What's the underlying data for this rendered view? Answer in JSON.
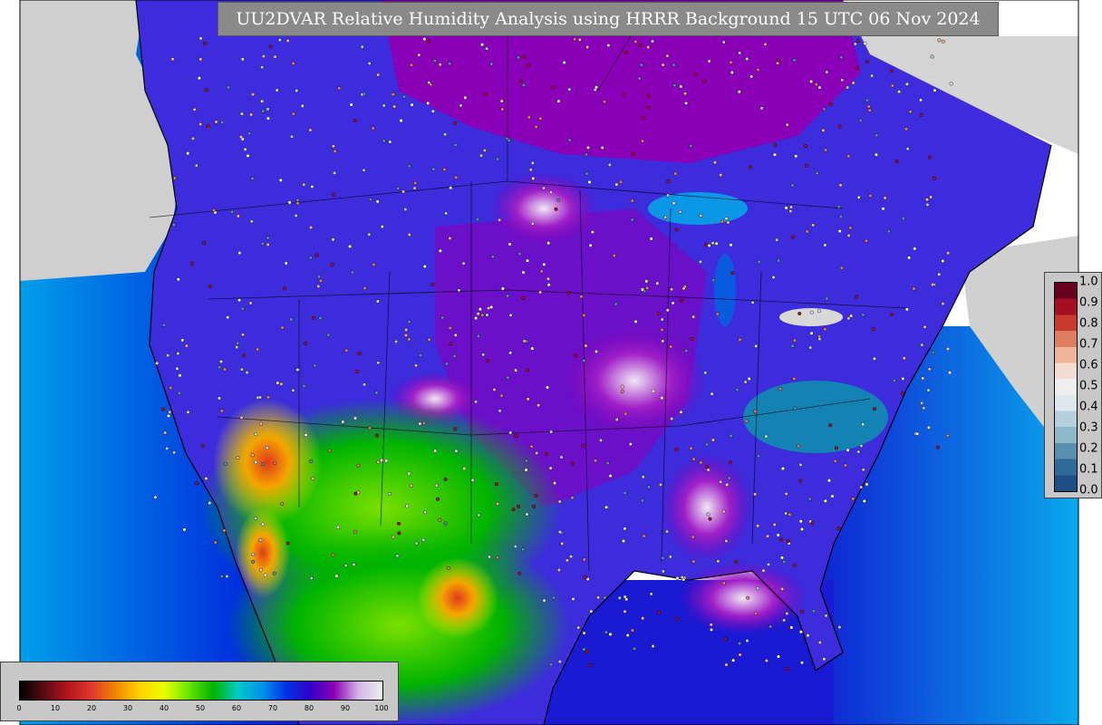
{
  "title": "UU2DVAR Relative Humidity Analysis using HRRR Background 15 UTC 06 Nov 2024",
  "rh_colorbar": {
    "ticks": [
      "0",
      "10",
      "20",
      "30",
      "40",
      "50",
      "60",
      "70",
      "80",
      "90",
      "100"
    ],
    "colors": [
      "#000000",
      "#5a0a12",
      "#b4161e",
      "#e03a2c",
      "#f08a00",
      "#ffd400",
      "#e6ff00",
      "#66e600",
      "#00b400",
      "#00c8c8",
      "#0096e6",
      "#0032e6",
      "#3200c8",
      "#8c00b4",
      "#d2b4e6",
      "#f0f0f0"
    ]
  },
  "fraction_colorbar": {
    "ticks": [
      "1.0",
      "0.9",
      "0.8",
      "0.7",
      "0.6",
      "0.5",
      "0.4",
      "0.3",
      "0.2",
      "0.1",
      "0.0"
    ],
    "colors": [
      "#67001f",
      "#a50f24",
      "#c8392f",
      "#de7d62",
      "#f0b49c",
      "#f3dcd0",
      "#eeeeee",
      "#dde8ee",
      "#b5cfdb",
      "#8eb7c8",
      "#5b8fb0",
      "#2f6a9a",
      "#1f4e84"
    ]
  },
  "colors": {
    "ocean_deep": "#0024d6",
    "ocean_light": "#0a96e6",
    "land_moist": "#8000b4",
    "land_dry": "#f0b000",
    "missing": "#cfcfcf"
  }
}
